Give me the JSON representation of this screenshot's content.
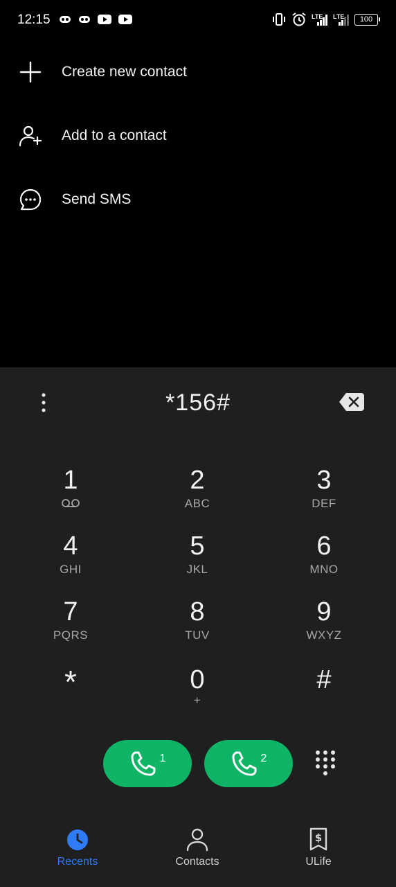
{
  "status_bar": {
    "time": "12:15",
    "battery": "100",
    "network_1": "LTE",
    "network_2": "LTE",
    "left_icons": [
      "game-controller-icon",
      "game-controller-icon",
      "youtube-icon",
      "youtube-icon"
    ],
    "right_icons": [
      "vibrate-icon",
      "alarm-icon",
      "signal-icon",
      "signal-icon",
      "battery-icon"
    ]
  },
  "menu": {
    "items": [
      {
        "label": "Create new contact",
        "icon": "plus-icon"
      },
      {
        "label": "Add to a contact",
        "icon": "add-person-icon"
      },
      {
        "label": "Send SMS",
        "icon": "message-bubble-icon"
      }
    ]
  },
  "dialer": {
    "number": "*156#",
    "keys": [
      {
        "digit": "1",
        "letters": "",
        "sub_icon": "voicemail-icon"
      },
      {
        "digit": "2",
        "letters": "ABC"
      },
      {
        "digit": "3",
        "letters": "DEF"
      },
      {
        "digit": "4",
        "letters": "GHI"
      },
      {
        "digit": "5",
        "letters": "JKL"
      },
      {
        "digit": "6",
        "letters": "MNO"
      },
      {
        "digit": "7",
        "letters": "PQRS"
      },
      {
        "digit": "8",
        "letters": "TUV"
      },
      {
        "digit": "9",
        "letters": "WXYZ"
      },
      {
        "digit": "*",
        "letters": ""
      },
      {
        "digit": "0",
        "letters": "+"
      },
      {
        "digit": "#",
        "letters": ""
      }
    ],
    "call_buttons": [
      {
        "sim": "1"
      },
      {
        "sim": "2"
      }
    ],
    "call_color": "#0fb466"
  },
  "bottom_nav": {
    "items": [
      {
        "label": "Recents",
        "icon": "clock-icon",
        "active": true
      },
      {
        "label": "Contacts",
        "icon": "person-icon",
        "active": false
      },
      {
        "label": "ULife",
        "icon": "ulife-icon",
        "active": false
      }
    ],
    "active_color": "#2f7bf6"
  }
}
